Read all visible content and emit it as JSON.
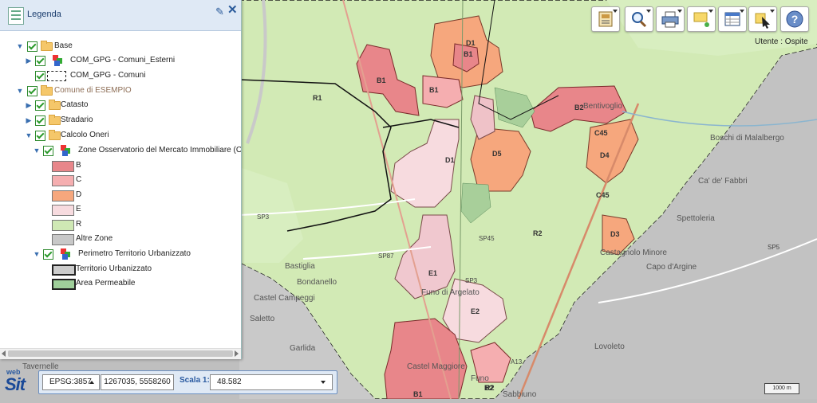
{
  "legend": {
    "title": "Legenda",
    "items": [
      {
        "label": "Base"
      },
      {
        "label": "COM_GPG - Comuni_Esterni"
      },
      {
        "label": "COM_GPG - Comuni"
      },
      {
        "label": "Comune di ESEMPIO"
      },
      {
        "label": "Catasto"
      },
      {
        "label": "Stradario"
      },
      {
        "label": "Calcolo Oneri"
      },
      {
        "label": "Zone Osservatorio del Mercato Immobiliare (OMI)"
      },
      {
        "label": "B"
      },
      {
        "label": "C"
      },
      {
        "label": "D"
      },
      {
        "label": "E"
      },
      {
        "label": "R"
      },
      {
        "label": "Altre Zone"
      },
      {
        "label": "Perimetro Territorio Urbanizzato"
      },
      {
        "label": "Territorio Urbanizzato"
      },
      {
        "label": "Area Permeabile"
      }
    ],
    "swatch_colors": {
      "B": "#e8868a",
      "C": "#f5aeb0",
      "D": "#f6a77d",
      "E": "#f7dbdf",
      "R": "#cfe8b4",
      "Altre Zone": "#c8c8c8",
      "Territorio Urbanizzato": "#cccccc",
      "Area Permeabile": "#9fcf9a"
    }
  },
  "toolbar": {
    "user_label": "Utente : Ospite",
    "icons": [
      "map-layers-icon",
      "zoom-icon",
      "print-icon",
      "notes-icon",
      "table-icon",
      "select-icon",
      "help-icon"
    ]
  },
  "bottom": {
    "logo_web": "web",
    "logo_sit": "Sit",
    "crs": "EPSG:3857",
    "coords": "1267035, 5558260",
    "scale_label": "Scala 1:",
    "scale_value": "48.582",
    "scalebar": "1000 m"
  },
  "map": {
    "zone_labels": [
      "B1",
      "B1",
      "D1",
      "B1",
      "B2",
      "D5",
      "D4",
      "D3",
      "D1",
      "E1",
      "E2",
      "B1",
      "B2",
      "R1",
      "R2",
      "R2",
      "C45",
      "C45"
    ],
    "place_labels": [
      "Castel Maggiore",
      "Bentivoglio",
      "Ca' de' Fabbri",
      "Sabbiuno",
      "Garlida",
      "Tavernelle",
      "Bondanello",
      "Castel Campeggi",
      "Funo di Argelato",
      "Lovoleto",
      "Boschi di Malalbergo",
      "Spettoleria",
      "Capo d'Argine",
      "Castagnolo Minore",
      "Bastiglia",
      "Saletto",
      "Funo"
    ],
    "road_labels": [
      "SP3",
      "SP87",
      "SP5",
      "SP3",
      "A13",
      "SP45"
    ],
    "colors": {
      "base": "#cfe8b4",
      "outside": "#bcbcbc",
      "B": "#e8868a",
      "C": "#f5aeb0",
      "D": "#f6a77d",
      "E": "#f7dbdf"
    }
  }
}
